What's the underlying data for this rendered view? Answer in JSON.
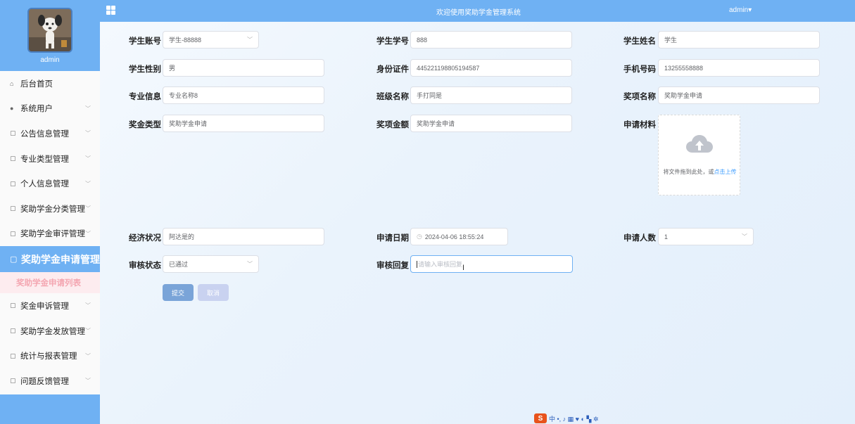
{
  "header": {
    "title": "欢迎使用奖助学金管理系统",
    "user": "admin▾"
  },
  "sidebar": {
    "username": "admin",
    "items": [
      {
        "label": "后台首页",
        "icon": "home-icon"
      },
      {
        "label": "系统用户",
        "icon": "user-icon"
      },
      {
        "label": "公告信息管理",
        "icon": "document-icon"
      },
      {
        "label": "专业类型管理",
        "icon": "document-icon"
      },
      {
        "label": "个人信息管理",
        "icon": "document-icon"
      },
      {
        "label": "奖助学金分类管理",
        "icon": "document-icon"
      },
      {
        "label": "奖助学金审评管理",
        "icon": "document-icon"
      }
    ],
    "active": {
      "label": "奖助学金申请管理",
      "icon": "document-icon"
    },
    "sub_active": "奖助学金申请列表",
    "items_after": [
      {
        "label": "奖金申诉管理",
        "icon": "document-icon"
      },
      {
        "label": "奖助学金发放管理",
        "icon": "document-icon"
      },
      {
        "label": "统计与报表管理",
        "icon": "document-icon"
      },
      {
        "label": "问题反馈管理",
        "icon": "document-icon"
      }
    ]
  },
  "form": {
    "student_account": {
      "label": "学生账号",
      "value": "学生-88888"
    },
    "student_id": {
      "label": "学生学号",
      "value": "888"
    },
    "student_name": {
      "label": "学生姓名",
      "value": "学生"
    },
    "gender": {
      "label": "学生性别",
      "value": "男"
    },
    "id_card": {
      "label": "身份证件",
      "value": "445221198805194587"
    },
    "phone": {
      "label": "手机号码",
      "value": "13255558888"
    },
    "major": {
      "label": "专业信息",
      "value": "专业名称8"
    },
    "class_name": {
      "label": "班级名称",
      "value": "手打同是"
    },
    "award_name": {
      "label": "奖项名称",
      "value": "奖助学金申请"
    },
    "award_type": {
      "label": "奖金类型",
      "value": "奖助学金申请"
    },
    "award_amount": {
      "label": "奖项金额",
      "value": "奖助学金申请"
    },
    "materials": {
      "label": "申请材料",
      "upload_text": "将文件拖到此处，或",
      "upload_link": "点击上传"
    },
    "economic": {
      "label": "经济状况",
      "value": "阿达是的"
    },
    "apply_date": {
      "label": "申请日期",
      "value": "2024-04-06 18:55:24"
    },
    "applicants": {
      "label": "申请人数",
      "value": "1"
    },
    "review_status": {
      "label": "审核状态",
      "value": "已通过"
    },
    "review_reply": {
      "label": "审核回复",
      "placeholder": "请输入审核回复"
    }
  },
  "buttons": {
    "submit": "提交",
    "cancel": "取消"
  },
  "ime": {
    "logo": "S",
    "text": "中 •, ♪ ▦ ♥ ◐ ▚ ✲"
  }
}
